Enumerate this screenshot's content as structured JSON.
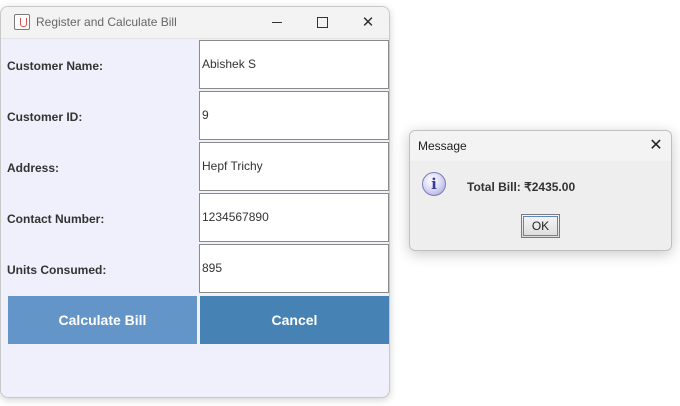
{
  "main_window": {
    "title": "Register and Calculate Bill",
    "close_glyph": "✕",
    "form": [
      {
        "label": "Customer Name:",
        "value": "Abishek S"
      },
      {
        "label": "Customer ID:",
        "value": "9"
      },
      {
        "label": "Address:",
        "value": "Hepf Trichy"
      },
      {
        "label": "Contact Number:",
        "value": "1234567890"
      },
      {
        "label": "Units Consumed:",
        "value": "895"
      }
    ],
    "buttons": {
      "calculate": "Calculate Bill",
      "cancel": "Cancel"
    },
    "colors": {
      "calculate_bg": "#6495c8",
      "cancel_bg": "#4682b4",
      "window_bg": "#f0f0fc"
    }
  },
  "message_dialog": {
    "title": "Message",
    "close_glyph": "✕",
    "icon": "info-icon",
    "icon_glyph": "i",
    "message": "Total Bill: ₹2435.00",
    "ok_label": "OK"
  }
}
